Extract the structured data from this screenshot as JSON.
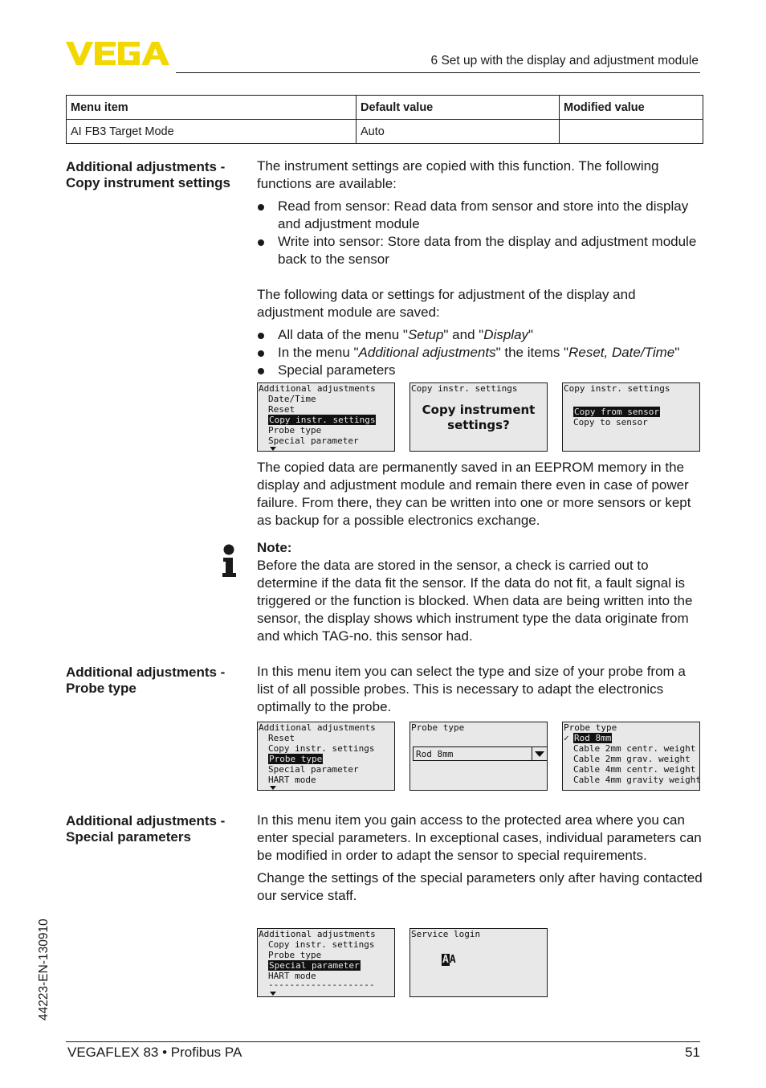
{
  "header": {
    "logo_text": "VEGA",
    "brand_color": "#f2d700",
    "chapter": "6 Set up with the display and adjustment module"
  },
  "table": {
    "columns": [
      "Menu item",
      "Default value",
      "Modified value"
    ],
    "rows": [
      [
        "AI FB3 Target Mode",
        "Auto",
        ""
      ]
    ]
  },
  "sections": {
    "copy": {
      "label_line1": "Additional adjustments -",
      "label_line2": "Copy instrument settings",
      "intro": "The instrument settings are copied with this function. The following functions are available:",
      "functions": [
        "Read from sensor: Read data from sensor and store into the display and adjustment module",
        "Write into sensor: Store data from the display and adjustment module back to the sensor"
      ],
      "saved_intro": "The following data or settings for adjustment of the display and adjustment module are saved:",
      "saved_items": [
        {
          "pre": "All data of the menu \"",
          "i1": "Setup",
          "mid": "\" and \"",
          "i2": "Display",
          "post": "\""
        },
        {
          "pre": "In the menu \"",
          "i1": "Additional adjustments",
          "mid": "\" the items \"",
          "i2": "Reset, Date/Time",
          "post": "\""
        },
        {
          "pre": "Special parameters",
          "i1": "",
          "mid": "",
          "i2": "",
          "post": ""
        }
      ],
      "eeprom_text": "The copied data are permanently saved in an EEPROM memory in the display and adjustment module and remain there even in case of power failure. From there, they can be written into one or more sensors or kept as backup for a possible electronics exchange.",
      "note_title": "Note:",
      "note_text": "Before the data are stored in the sensor, a check is carried out to determine if the data fit the sensor. If the data do not fit, a fault signal is triggered or the function is blocked. When data are being written into the sensor, the display shows which instrument type the data originate from and which TAG-no. this sensor had.",
      "displays": {
        "menu": {
          "title": "Additional adjustments",
          "items": [
            "Date/Time",
            "Reset",
            "Copy instr. settings",
            "Probe type",
            "Special parameter"
          ],
          "selected_index": 2
        },
        "confirm": {
          "title": "Copy instr. settings",
          "line1": "Copy instrument",
          "line2": "settings?"
        },
        "choice": {
          "title": "Copy instr. settings",
          "items": [
            "Copy from sensor",
            "Copy to sensor"
          ],
          "selected_index": 0
        }
      }
    },
    "probe": {
      "label_line1": "Additional adjustments -",
      "label_line2": "Probe type",
      "text": "In this menu item you can select the type and size of your probe from a list of all possible probes. This is necessary to adapt the electronics optimally to the probe.",
      "displays": {
        "menu": {
          "title": "Additional adjustments",
          "items": [
            "Reset",
            "Copy instr. settings",
            "Probe type",
            "Special parameter",
            "HART mode"
          ],
          "selected_index": 2
        },
        "select": {
          "title": "Probe type",
          "value": "Rod 8mm"
        },
        "list": {
          "title": "Probe type",
          "items": [
            "Rod 8mm",
            "Cable 2mm centr. weight",
            "Cable 2mm grav. weight",
            "Cable 4mm centr. weight",
            "Cable 4mm gravity weight"
          ],
          "selected_index": 0,
          "check_mark": "✓"
        }
      }
    },
    "special": {
      "label_line1": "Additional adjustments -",
      "label_line2": "Special parameters",
      "text1": "In this menu item you gain access to the protected area where you can enter special parameters. In exceptional cases, individual parameters can be modified in order to adapt the sensor to special requirements.",
      "text2": "Change the settings of the special parameters only after having contacted our service staff.",
      "displays": {
        "menu": {
          "title": "Additional adjustments",
          "items": [
            "Copy instr. settings",
            "Probe type",
            "Special parameter",
            "HART mode"
          ],
          "selected_index": 2,
          "separator": "--------------------"
        },
        "login": {
          "title": "Service login",
          "cursor_char": "A",
          "next_char": "A"
        }
      }
    }
  },
  "footer": {
    "product": "VEGAFLEX 83 • Profibus PA",
    "page": "51",
    "doc_id": "44223-EN-130910"
  }
}
